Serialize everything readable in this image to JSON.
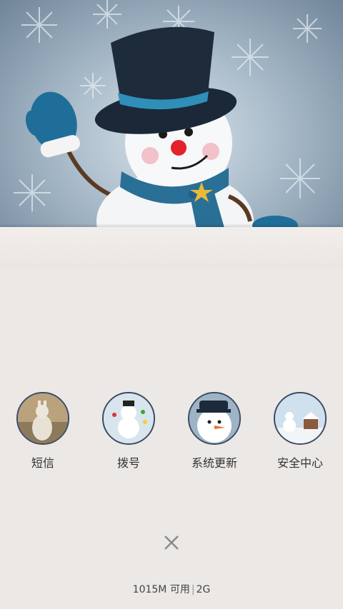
{
  "apps": [
    {
      "label": "短信",
      "icon": "sms-snowman-icon"
    },
    {
      "label": "拨号",
      "icon": "dialer-snowman-icon"
    },
    {
      "label": "系统更新",
      "icon": "update-snowman-icon"
    },
    {
      "label": "安全中心",
      "icon": "security-snowman-icon"
    }
  ],
  "status": {
    "memory": "1015M 可用",
    "network": "2G"
  },
  "close_icon": "close-icon",
  "colors": {
    "background": "#ebe8e6",
    "icon_border": "#3b4a63",
    "scarf": "#2a6f95",
    "hat": "#1d2b3b"
  }
}
